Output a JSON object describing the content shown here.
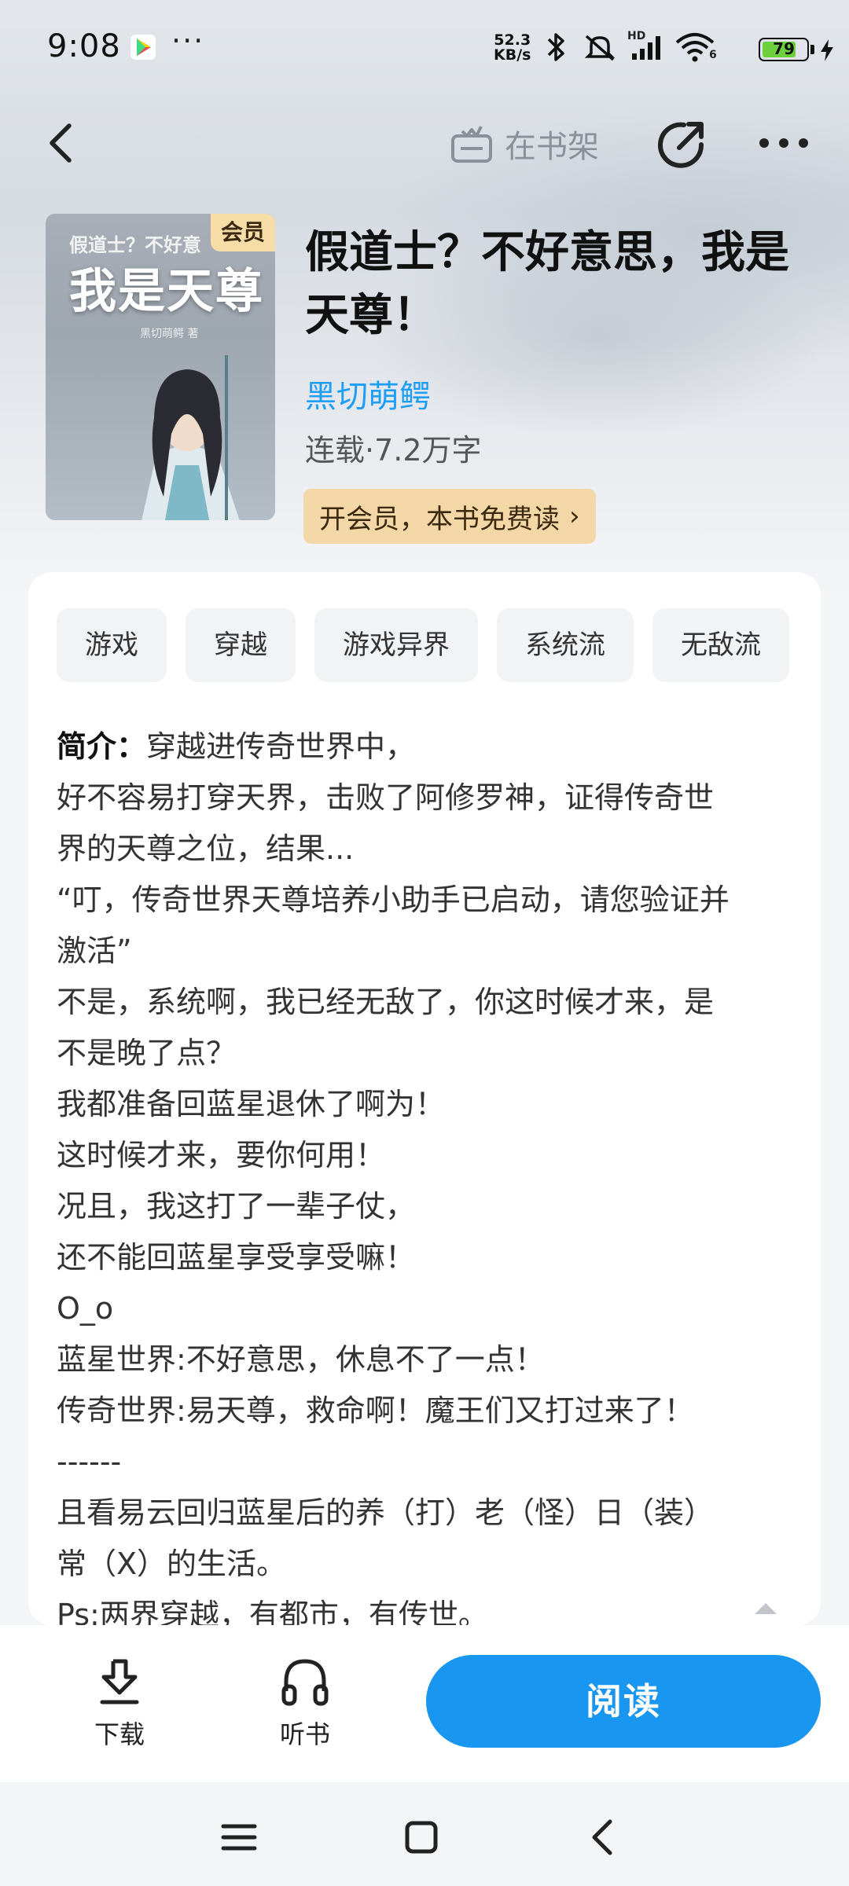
{
  "status_bar": {
    "time": "9:08",
    "net_speed_value": "52.3",
    "net_speed_unit": "KB/s",
    "network_type": "HD",
    "wifi_label": "6",
    "battery_level": "79",
    "battery_percent": 79
  },
  "nav": {
    "shelf_label": "在书架"
  },
  "book": {
    "cover_top_text": "假道士？不好意",
    "cover_title_text": "我是天尊",
    "cover_author_text": "黑切萌鳄 著",
    "vip_badge": "会员",
    "title": "假道士？不好意思，我是天尊！",
    "author": "黑切萌鳄",
    "meta": "连载·7.2万字",
    "vip_cta": "开会员，本书免费读",
    "vip_cta_chevron": "›"
  },
  "tags": [
    "游戏",
    "穿越",
    "游戏异界",
    "系统流",
    "无敌流"
  ],
  "synopsis": {
    "label": "简介：",
    "lines": [
      "穿越进传奇世界中，",
      "好不容易打穿天界，击败了阿修罗神，证得传奇世",
      "界的天尊之位，结果...",
      "“叮，传奇世界天尊培养小助手已启动，请您验证并",
      "激活”",
      "不是，系统啊，我已经无敌了，你这时候才来，是",
      "不是晚了点？",
      "我都准备回蓝星退休了啊为！",
      "这时候才来，要你何用！",
      "况且，我这打了一辈子仗，",
      "还不能回蓝星享受享受嘛！",
      "O_o",
      "蓝星世界:不好意思，休息不了一点！",
      "传奇世界:易天尊，救命啊！魔王们又打过来了！",
      "------",
      "且看易云回归蓝星后的养（打）老（怪）日（装）",
      "常（X）的生活。",
      "Ps:两界穿越，有都市，有传世。"
    ]
  },
  "bottom_bar": {
    "download_label": "下载",
    "listen_label": "听书",
    "read_label": "阅读"
  },
  "colors": {
    "accent": "#1896f0",
    "author_link": "#1e9ef5",
    "vip_gold": "#f4d7a6",
    "battery_green": "#6bd03c"
  }
}
